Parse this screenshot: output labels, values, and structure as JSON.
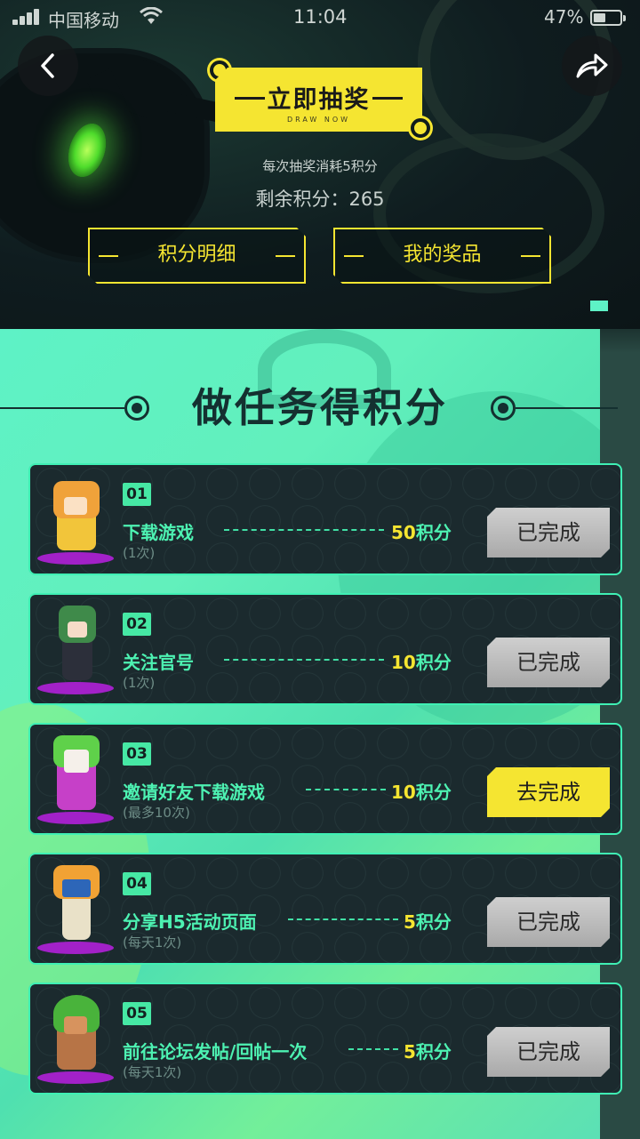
{
  "status_bar": {
    "carrier": "中国移动",
    "time": "11:04",
    "battery": "47%"
  },
  "draw": {
    "label": "立即抽奖",
    "sublabel": "DRAW NOW",
    "cost_text": "每次抽奖消耗5积分",
    "remaining_text": "剩余积分：265"
  },
  "buttons": {
    "points_detail": "积分明细",
    "my_prizes": "我的奖品"
  },
  "section": {
    "title": "做任务得积分"
  },
  "tasks": [
    {
      "num": "01",
      "name": "下载游戏",
      "note": "(1次)",
      "points": "50",
      "unit": "积分",
      "action": "已完成",
      "done": true
    },
    {
      "num": "02",
      "name": "关注官号",
      "note": "(1次)",
      "points": "10",
      "unit": "积分",
      "action": "已完成",
      "done": true
    },
    {
      "num": "03",
      "name": "邀请好友下载游戏",
      "note": "(最多10次)",
      "points": "10",
      "unit": "积分",
      "action": "去完成",
      "done": false
    },
    {
      "num": "04",
      "name": "分享H5活动页面",
      "note": "(每天1次)",
      "points": "5",
      "unit": "积分",
      "action": "已完成",
      "done": true
    },
    {
      "num": "05",
      "name": "前往论坛发帖/回帖一次",
      "note": "(每天1次)",
      "points": "5",
      "unit": "积分",
      "action": "已完成",
      "done": true
    }
  ],
  "colors": {
    "accent_yellow": "#f5e531",
    "accent_green": "#4df2b2",
    "card_bg": "#1b2a2e"
  },
  "icons": {
    "back": "chevron-left-icon",
    "share": "share-arrow-icon"
  }
}
